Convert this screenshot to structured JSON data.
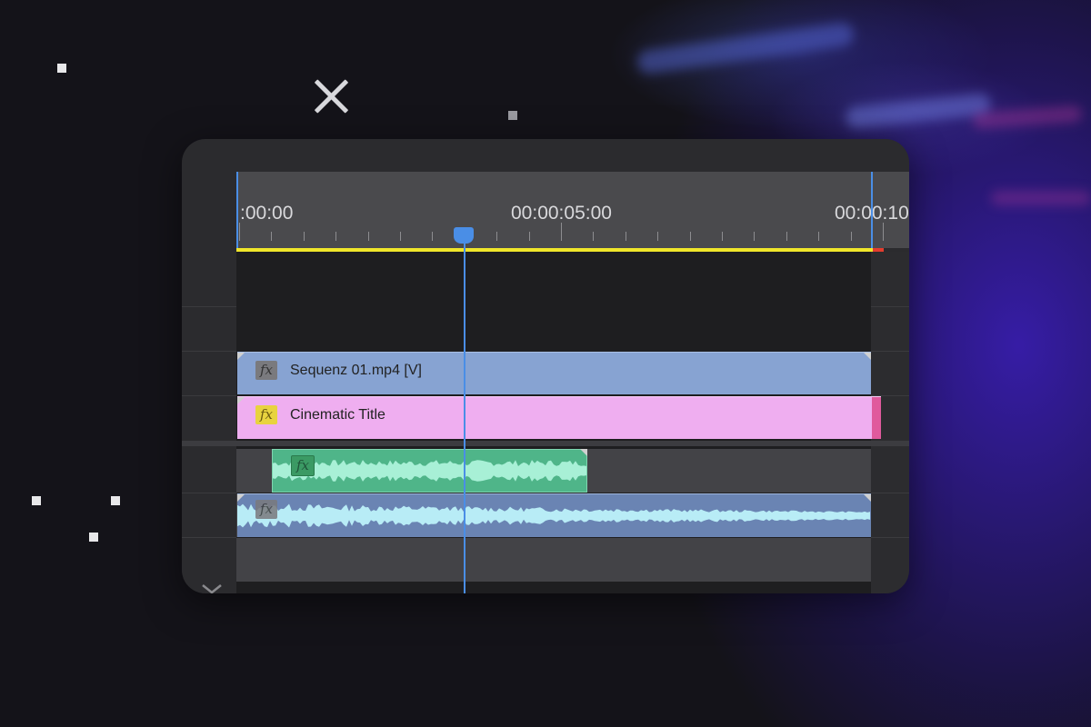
{
  "timeline": {
    "ruler": {
      "labels": [
        ":00:00",
        "00:00:05:00",
        "00:00:10"
      ]
    },
    "tracks": {
      "video_clip": {
        "name": "Sequenz 01.mp4 [V]",
        "fx_icon": "fx-badge-icon",
        "color": "#87a3d2"
      },
      "title_clip": {
        "name": "Cinematic Title",
        "fx_icon": "fx-badge-icon",
        "color": "#efaef0"
      },
      "audio_clip_1": {
        "fx_icon": "fx-badge-icon",
        "color": "#4fb589"
      },
      "audio_clip_2": {
        "fx_icon": "fx-badge-icon",
        "color": "#6a84b3"
      }
    },
    "fx_label": "fx",
    "colors": {
      "playhead": "#4a8ee6",
      "work_area": "#f0e62a",
      "accent_glow": "#3c1ebe"
    }
  },
  "overlay": {
    "close_icon": "close-icon"
  }
}
